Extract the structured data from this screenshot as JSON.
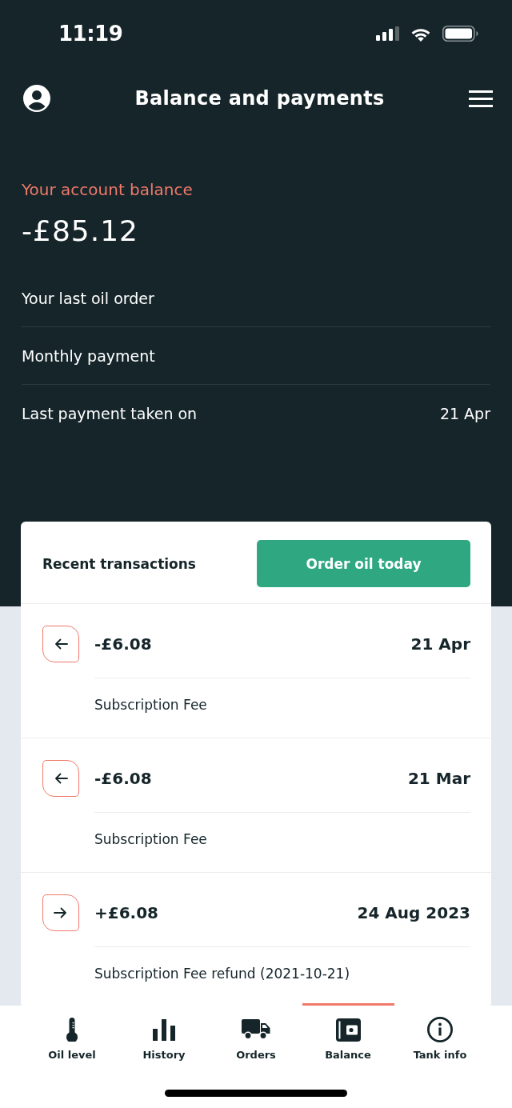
{
  "status_bar": {
    "time": "11:19"
  },
  "header": {
    "title": "Balance and payments"
  },
  "balance": {
    "label": "Your account balance",
    "amount": "-£85.12"
  },
  "details": [
    {
      "label": "Your last oil order"
    },
    {
      "label": "Monthly payment"
    },
    {
      "label": "Last payment taken on",
      "value": "21 Apr"
    }
  ],
  "transactions": {
    "title": "Recent transactions",
    "button": "Order oil today",
    "items": [
      {
        "kind": "debit",
        "amount": "-£6.08",
        "date": "21 Apr",
        "description": "Subscription Fee"
      },
      {
        "kind": "debit",
        "amount": "-£6.08",
        "date": "21 Mar",
        "description": "Subscription Fee"
      },
      {
        "kind": "credit",
        "amount": "+£6.08",
        "date": "24 Aug 2023",
        "description": "Subscription Fee refund (2021-10-21)"
      }
    ]
  },
  "nav": [
    {
      "label": "Oil level",
      "selected": false
    },
    {
      "label": "History",
      "selected": false
    },
    {
      "label": "Orders",
      "selected": false
    },
    {
      "label": "Balance",
      "selected": true
    },
    {
      "label": "Tank info",
      "selected": false
    }
  ]
}
